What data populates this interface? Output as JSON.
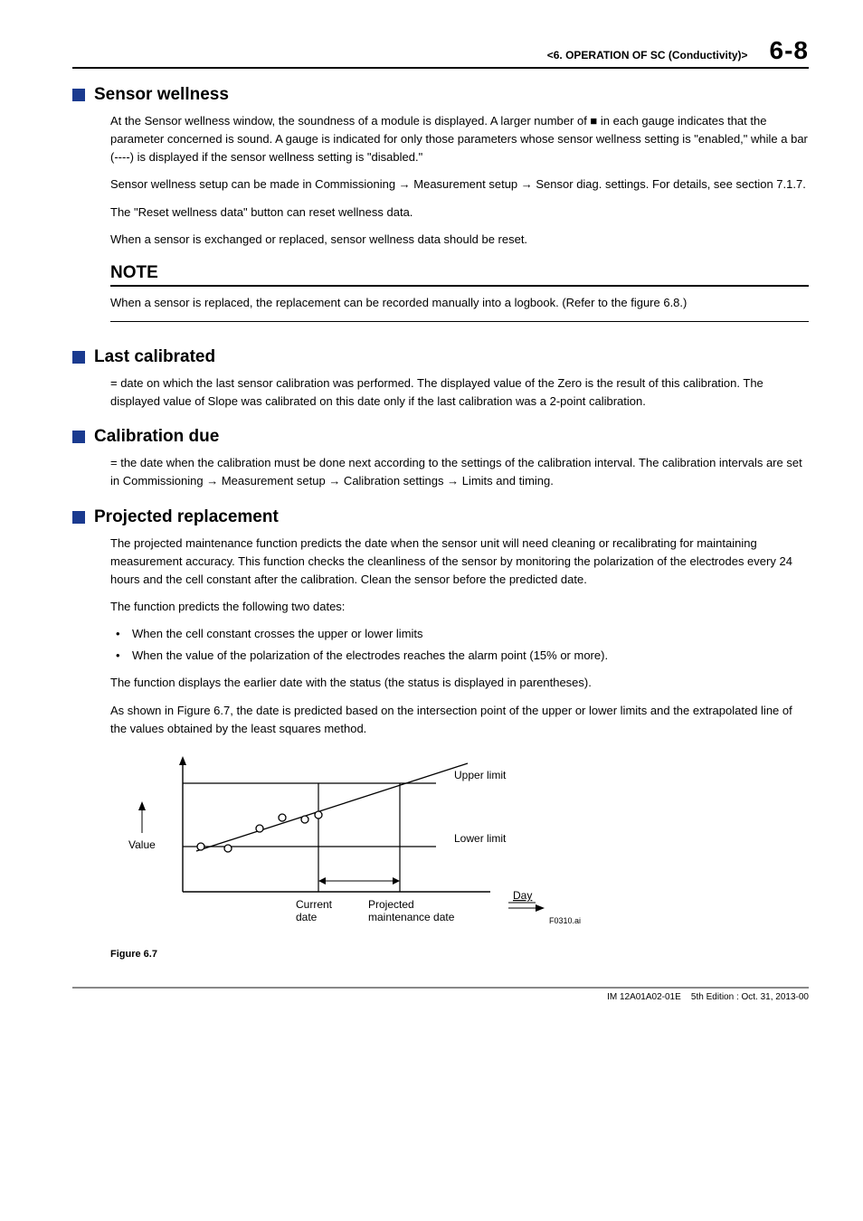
{
  "header": {
    "section_title": "<6.  OPERATION OF SC (Conductivity)>",
    "page_number": "6-8"
  },
  "sec_sensor": {
    "heading": "Sensor wellness",
    "p1": "At the Sensor wellness window, the soundness of a module is displayed. A larger number of ■ in each gauge indicates that the parameter concerned is sound. A gauge is indicated for only those parameters whose sensor wellness setting is \"enabled,\" while a bar (----) is displayed if the sensor wellness setting is \"disabled.\"",
    "p2": "Sensor wellness setup can be made in Commissioning → Measurement setup → Sensor diag. settings. For details, see section 7.1.7.",
    "p3": "The \"Reset wellness data\" button can reset wellness data.",
    "p4": "When a sensor is exchanged or replaced, sensor wellness data should be reset."
  },
  "note": {
    "heading": "NOTE",
    "body": "When a sensor is replaced, the replacement can be recorded manually into a logbook. (Refer to the figure 6.8.)"
  },
  "sec_last": {
    "heading": "Last calibrated",
    "p1": "= date on which the last sensor calibration was performed. The displayed value of the Zero is the result of this calibration. The displayed value of Slope was calibrated on this date only if the last calibration was a 2-point calibration."
  },
  "sec_caldue": {
    "heading": "Calibration due",
    "p1": "= the date when the calibration must be done next according to the settings of the calibration interval. The calibration intervals are set in Commissioning → Measurement setup → Calibration settings → Limits and timing."
  },
  "sec_proj": {
    "heading": "Projected replacement",
    "p1": "The projected maintenance function predicts the date when the sensor unit will need cleaning or recalibrating for maintaining measurement accuracy. This function checks the cleanliness of the sensor by monitoring the polarization of the electrodes every 24 hours and the cell constant after the calibration. Clean the sensor before the predicted date.",
    "p2": "The function predicts the following two dates:",
    "b1": "When the cell constant crosses the upper or lower limits",
    "b2": "When the value of the polarization of the electrodes reaches the alarm point (15% or more).",
    "p3": "The function displays the earlier date with the status (the status is displayed in parentheses).",
    "p4": "As shown in Figure 6.7, the date is predicted based on the intersection point of the upper or lower limits and the extrapolated line of the values obtained by the least squares method."
  },
  "figure": {
    "caption": "Figure 6.7",
    "labels": {
      "value": "Value",
      "upper": "Upper limit",
      "lower": "Lower limit",
      "current_l1": "Current",
      "current_l2": "date",
      "proj_l1": "Projected",
      "proj_l2": "maintenance date",
      "day": "Day",
      "code": "F0310.ai"
    }
  },
  "footer": {
    "doc": "IM 12A01A02-01E",
    "edition": "5th Edition : Oct. 31, 2013-00"
  },
  "chart_data": {
    "type": "line",
    "description": "Schematic of extrapolated sensor value crossing upper limit over time",
    "x": "Day",
    "y": "Value",
    "limits": {
      "upper": "Upper limit",
      "lower": "Lower limit"
    },
    "series": [
      {
        "name": "measured (least-squares fit)",
        "points_schematic": [
          "rising from lower-left through scattered samples toward upper limit"
        ]
      }
    ],
    "markers": {
      "current_date": "vertical reference at last measured day",
      "projected_maintenance_date": "intersection of extrapolated line with upper limit"
    }
  }
}
